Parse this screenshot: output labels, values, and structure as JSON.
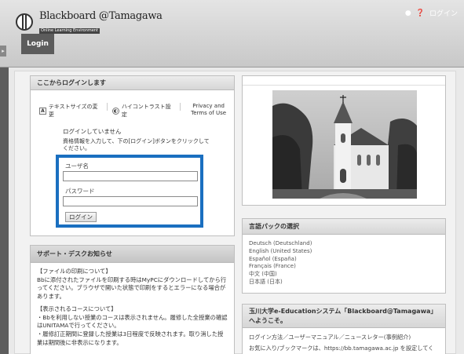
{
  "header": {
    "logo_main": "Blackboard @Tamagawa",
    "logo_sub": "Online Learning Environment",
    "top_right_text": "ログイン",
    "tab_label": "Login"
  },
  "login": {
    "title": "ここからログインします",
    "text_size": "テキストサイズの変更",
    "high_contrast": "ハイコントラスト設定",
    "privacy": "Privacy and Terms of Use",
    "status": "ログインしていません",
    "instruction": "資格情報を入力して、下の[ログイン]ボタンをクリックしてください。",
    "user_label": "ユーザ名",
    "password_label": "パスワード",
    "button": "ログイン"
  },
  "support": {
    "title": "サポート・デスクお知らせ",
    "p1_head": "【ファイルの印刷について】",
    "p1_body": "Bbに添付されたファイルを印刷する時はMyPCにダウンロードしてから行ってください。ブラウザで開いた状態で印刷をするとエラーになる場合があります。",
    "p2_head": "【表示されるコースについて】",
    "p2_l1": "・Bbを利用しない授業のコースは表示されません。履修した全授業の確認はUNITAMAで行ってください。",
    "p2_l2": "・履修訂正期間に登録した授業は3日程度で反映されます。取り消した授業は期間後に非表示になります。"
  },
  "language": {
    "title": "言語パックの選択",
    "items": [
      "Deutsch (Deutschland)",
      "English (United States)",
      "Español (España)",
      "Français (France)",
      "中文 (中国)",
      "日本語 (日本)"
    ]
  },
  "welcome": {
    "title": "玉川大学e-Educationシステム「Blackboard@Tamagawa」へようこそ。",
    "line1": "ログイン方法／ユーザーマニュアル／ニュースレター(事例紹介)",
    "line2": "お気に入り/ブックマークは、https://bb.tamagawa.ac.jp を設定してく"
  },
  "colors": {
    "accent": "#1a6fc0",
    "header_bg": "#d4d4d4",
    "tab_bg": "#5c5c5c"
  }
}
